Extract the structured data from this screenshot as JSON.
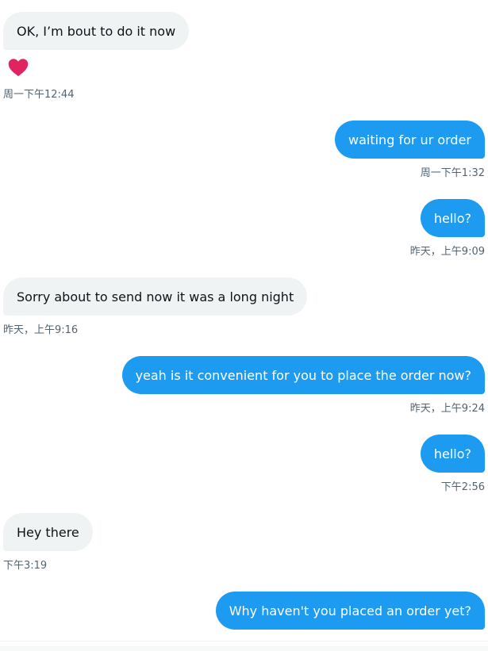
{
  "messages": [
    {
      "text": "OK, I’m bout to do it now",
      "time": "周一下午12:44",
      "reaction": "heart"
    },
    {
      "text": "waiting for ur order",
      "time": "周一下午1:32"
    },
    {
      "text": "hello?",
      "time": "昨天，上午9:09"
    },
    {
      "text": "Sorry about to send now it was a long night",
      "time": "昨天，上午9:16"
    },
    {
      "text": "yeah is it convenient for you to place the order now?",
      "time": "昨天，上午9:24"
    },
    {
      "text": "hello?",
      "time": "下午2:56"
    },
    {
      "text": "Hey there",
      "time": "下午3:19"
    },
    {
      "text": "Why haven't you placed an order yet?",
      "time": ""
    }
  ],
  "colors": {
    "outgoing": "#1d9bf0",
    "incoming": "#eff3f4",
    "timestamp": "#536471",
    "heart": "#f91880"
  }
}
